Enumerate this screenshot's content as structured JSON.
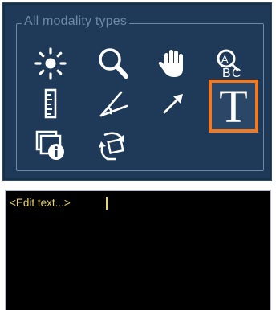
{
  "tool_group": {
    "title": "All modality types",
    "tools": [
      {
        "name": "brightness-contrast",
        "icon": "sun-icon"
      },
      {
        "name": "zoom",
        "icon": "magnifier-icon"
      },
      {
        "name": "pan",
        "icon": "hand-icon"
      },
      {
        "name": "spell-check",
        "icon": "abc-check-icon"
      },
      {
        "name": "ruler",
        "icon": "ruler-icon"
      },
      {
        "name": "angle",
        "icon": "angle-icon"
      },
      {
        "name": "arrow",
        "icon": "arrow-icon"
      },
      {
        "name": "text-annotation",
        "icon": "text-t-icon",
        "glyph": "T",
        "selected": true
      },
      {
        "name": "image-info",
        "icon": "image-info-icon"
      },
      {
        "name": "rotate-flip",
        "icon": "rotate-icon"
      }
    ]
  },
  "editor": {
    "text": "<Edit text...>"
  },
  "colors": {
    "panel_bg": "#1e3a58",
    "group_title": "#6f8aa8",
    "selected_border": "#f07a24",
    "editor_bg": "#000000",
    "editor_text": "#e6d36a"
  }
}
